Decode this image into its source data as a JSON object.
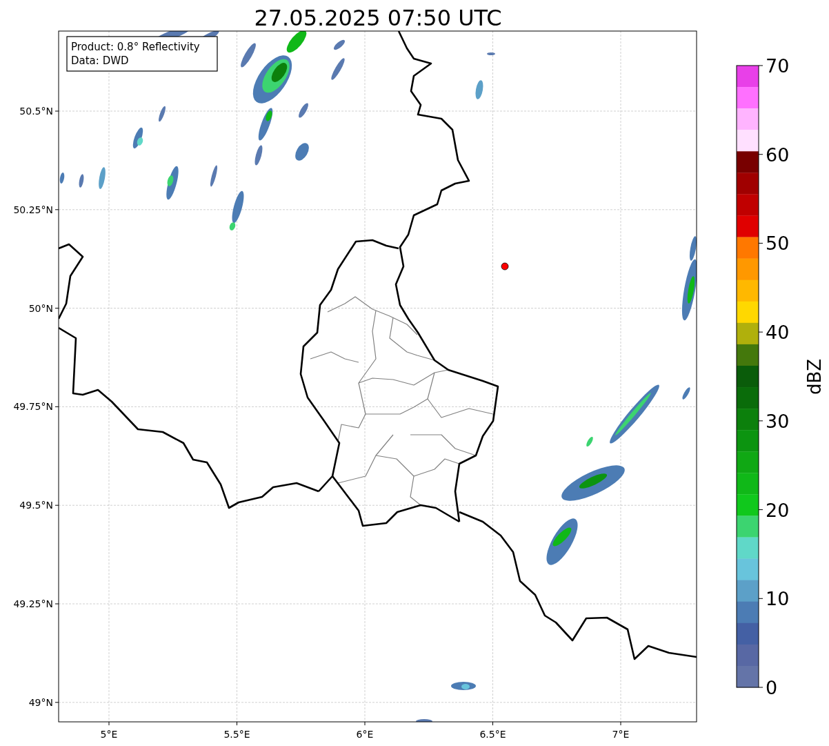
{
  "title": "27.05.2025 07:50 UTC",
  "info_box": [
    "Product: 0.8° Reflectivity",
    "Data: DWD"
  ],
  "map": {
    "x_ticks": [
      "5°E",
      "5.5°E",
      "6°E",
      "6.5°E",
      "7°E"
    ],
    "y_ticks": [
      "50.5°N",
      "50.25°N",
      "50°N",
      "49.75°N",
      "49.5°N",
      "49.25°N",
      "49°N"
    ]
  },
  "colorbar": {
    "label": "dBZ",
    "ticks": [
      "70",
      "60",
      "50",
      "40",
      "30",
      "20",
      "10",
      "0"
    ],
    "segments": [
      {
        "color": "#e840e8"
      },
      {
        "color": "#ff70ff"
      },
      {
        "color": "#ffb4ff"
      },
      {
        "color": "#ffe0ff"
      },
      {
        "color": "#780000"
      },
      {
        "color": "#a00000"
      },
      {
        "color": "#c00000"
      },
      {
        "color": "#e00000"
      },
      {
        "color": "#ff7800"
      },
      {
        "color": "#ff9800"
      },
      {
        "color": "#ffb800"
      },
      {
        "color": "#ffd800"
      },
      {
        "color": "#b0b00c"
      },
      {
        "color": "#44780c"
      },
      {
        "color": "#0a5c0a"
      },
      {
        "color": "#0a6c0a"
      },
      {
        "color": "#0c800c"
      },
      {
        "color": "#0c9410"
      },
      {
        "color": "#10a814"
      },
      {
        "color": "#10b818"
      },
      {
        "color": "#10c81c"
      },
      {
        "color": "#3cd470"
      },
      {
        "color": "#60d8c8"
      },
      {
        "color": "#68c4dc"
      },
      {
        "color": "#5ca0c8"
      },
      {
        "color": "#4c7cb4"
      },
      {
        "color": "#4460a4"
      },
      {
        "color": "#5868a4"
      },
      {
        "color": "#6474a8"
      }
    ]
  }
}
